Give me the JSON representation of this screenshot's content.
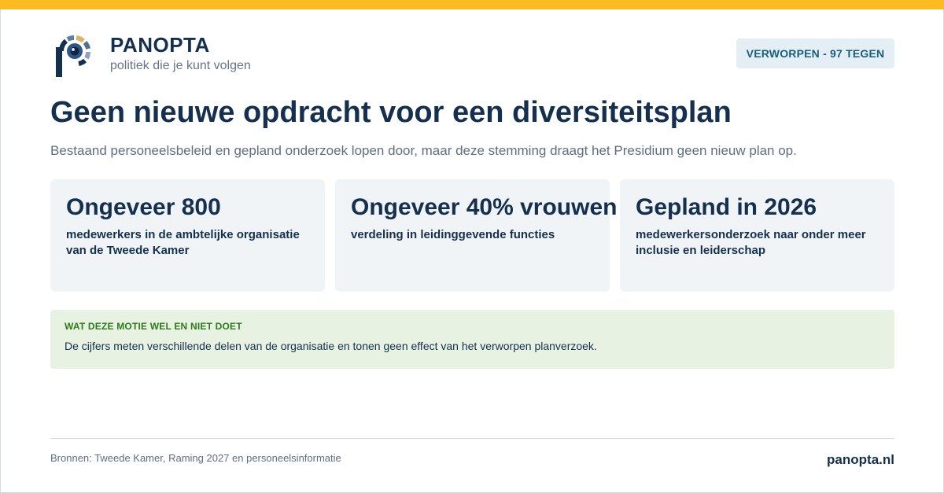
{
  "brand": {
    "name": "PANOPTA",
    "tagline": "politiek die je kunt volgen",
    "logo_icon": "panopta-eye-logo"
  },
  "status_badge": "VERWORPEN - 97 TEGEN",
  "headline": {
    "title": "Geen nieuwe opdracht voor een diversiteitsplan",
    "subtitle": "Bestaand personeelsbeleid en gepland onderzoek lopen door, maar deze stemming draagt het Presidium geen nieuw plan op."
  },
  "stats": [
    {
      "value": "Ongeveer 800",
      "description": "medewerkers in de ambtelijke organisatie van de Tweede Kamer"
    },
    {
      "value": "Ongeveer 40% vrouwen",
      "description": "verdeling in leidinggevende functies"
    },
    {
      "value": "Gepland in 2026",
      "description": "medewerkersonderzoek naar onder meer inclusie en leiderschap"
    }
  ],
  "note": {
    "label": "WAT DEZE MOTIE WEL EN NIET DOET",
    "text": "De cijfers meten verschillende delen van de organisatie en tonen geen effect van het verworpen planverzoek."
  },
  "footer": {
    "sources": "Bronnen: Tweede Kamer, Raming 2027 en personeelsinformatie",
    "site": "panopta.nl"
  },
  "colors": {
    "accent_bar": "#fbbb21",
    "navy": "#14304e",
    "badge_bg": "#e3eef5",
    "badge_text": "#1b5d7e",
    "card_bg": "#f1f4f7",
    "note_bg": "#e7f2e2",
    "note_label": "#2f7a1a"
  }
}
